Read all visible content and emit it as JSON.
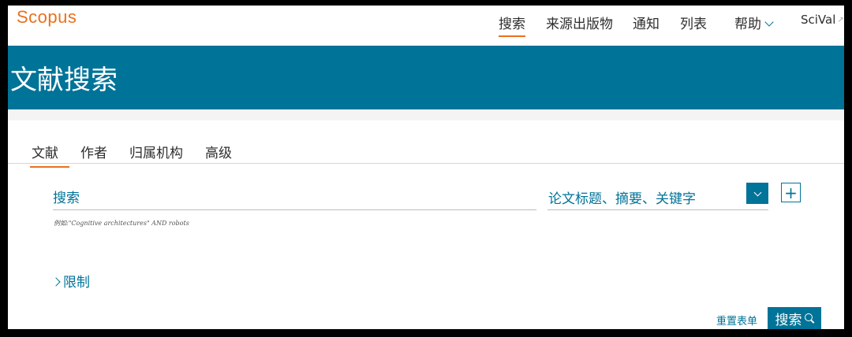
{
  "header": {
    "logo": "Scopus",
    "nav": [
      {
        "label": "搜索",
        "active": true
      },
      {
        "label": "来源出版物"
      },
      {
        "label": "通知"
      },
      {
        "label": "列表"
      },
      {
        "label": "帮助"
      },
      {
        "label": "SciVal"
      }
    ],
    "external_mark": "↗"
  },
  "banner": {
    "title": "文献搜索"
  },
  "tabs": [
    {
      "label": "文献",
      "active": true
    },
    {
      "label": "作者"
    },
    {
      "label": "归属机构"
    },
    {
      "label": "高级"
    }
  ],
  "search": {
    "placeholder": "搜索",
    "example": "例如:\"Cognitive architectures\" AND robots",
    "field_selected": "论文标题、摘要、关键字",
    "add_field_symbol": "+"
  },
  "limits": {
    "label": "限制"
  },
  "actions": {
    "reset_label": "重置表单",
    "search_label": "搜索"
  },
  "colors": {
    "accent": "#e9711c",
    "brand": "#007398"
  }
}
